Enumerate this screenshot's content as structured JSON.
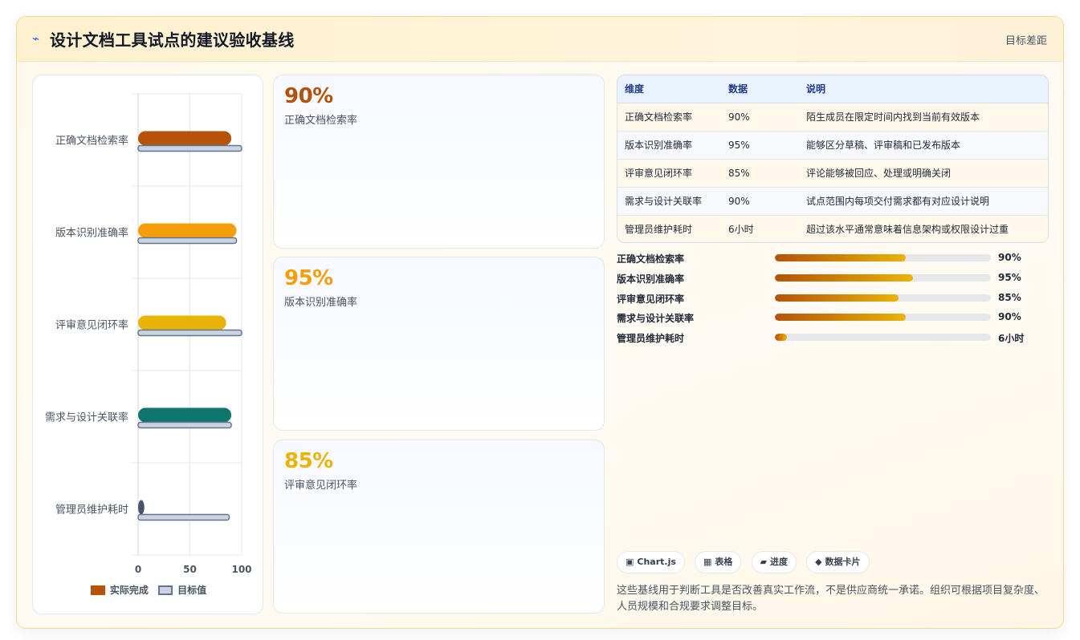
{
  "header": {
    "title_icon": "bolt-icon",
    "title": "设计文档工具试点的建议验收基线",
    "right_label": "目标差距"
  },
  "colors": {
    "actual": [
      "#b45309",
      "#f59e0b",
      "#eab308",
      "#0f766e",
      "#475569"
    ],
    "target_fill": "#cbd5e1",
    "target_stroke": "#64748b",
    "kpi": [
      "#b45309",
      "#f59e0b",
      "#eab308"
    ]
  },
  "chart_data": {
    "type": "bar",
    "orientation": "horizontal",
    "categories": [
      "正确文档检索率",
      "版本识别准确率",
      "评审意见闭环率",
      "需求与设计关联率",
      "管理员维护耗时"
    ],
    "series": [
      {
        "name": "实际完成",
        "values": [
          90,
          95,
          85,
          90,
          6
        ]
      },
      {
        "name": "目标值",
        "values": [
          100,
          95,
          100,
          90,
          88
        ]
      }
    ],
    "xlim": [
      0,
      100
    ],
    "xticks": [
      "0",
      "50",
      "100"
    ],
    "grid": true,
    "legend": "bottom"
  },
  "kpis": [
    {
      "value": "90%",
      "label": "正确文档检索率"
    },
    {
      "value": "95%",
      "label": "版本识别准确率"
    },
    {
      "value": "85%",
      "label": "评审意见闭环率"
    }
  ],
  "table": {
    "headers": [
      "维度",
      "数据",
      "说明"
    ],
    "rows": [
      [
        "正确文档检索率",
        "90%",
        "陌生成员在限定时间内找到当前有效版本"
      ],
      [
        "版本识别准确率",
        "95%",
        "能够区分草稿、评审稿和已发布版本"
      ],
      [
        "评审意见闭环率",
        "85%",
        "评论能够被回应、处理或明确关闭"
      ],
      [
        "需求与设计关联率",
        "90%",
        "试点范围内每项交付需求都有对应设计说明"
      ],
      [
        "管理员维护耗时",
        "6小时",
        "超过该水平通常意味着信息架构或权限设计过重"
      ]
    ]
  },
  "progress": [
    {
      "label": "正确文档检索率",
      "value": "90%",
      "fill": 0.605
    },
    {
      "label": "版本识别准确率",
      "value": "95%",
      "fill": 0.638
    },
    {
      "label": "评审意见闭环率",
      "value": "85%",
      "fill": 0.571
    },
    {
      "label": "需求与设计关联率",
      "value": "90%",
      "fill": 0.605
    },
    {
      "label": "管理员维护耗时",
      "value": "6小时",
      "fill": 0.055
    }
  ],
  "tags": [
    {
      "icon": "▣",
      "label": "Chart.js"
    },
    {
      "icon": "▦",
      "label": "表格"
    },
    {
      "icon": "▰",
      "label": "进度"
    },
    {
      "icon": "◆",
      "label": "数据卡片"
    }
  ],
  "footnote": "这些基线用于判断工具是否改善真实工作流，不是供应商统一承诺。组织可根据项目复杂度、人员规模和合规要求调整目标。"
}
